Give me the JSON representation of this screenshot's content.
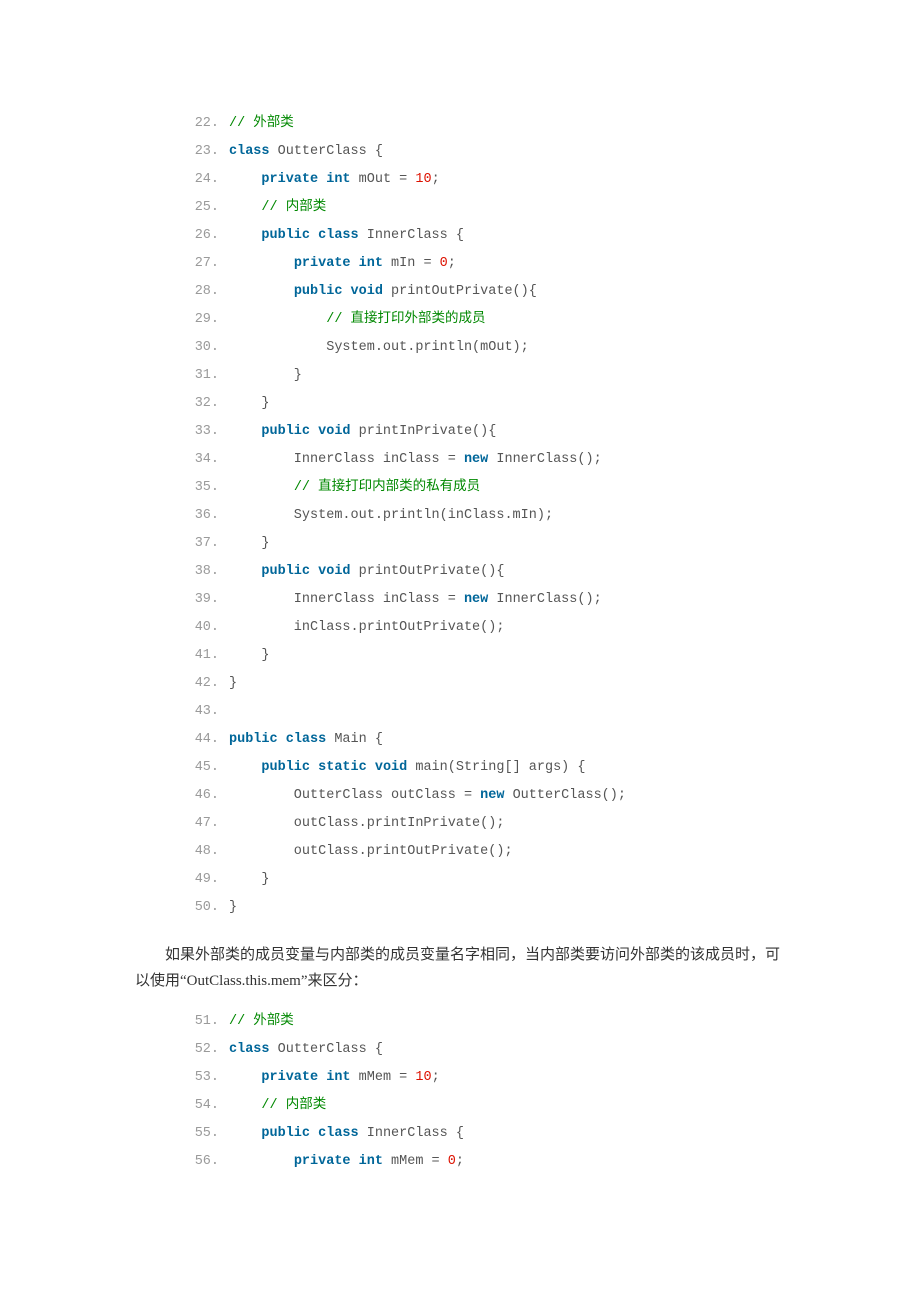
{
  "block1": {
    "lines": [
      {
        "n": 22,
        "tokens": [
          {
            "t": "cm",
            "v": "// 外部类"
          }
        ]
      },
      {
        "n": 23,
        "tokens": [
          {
            "t": "kw",
            "v": "class"
          },
          {
            "t": "",
            "v": " OutterClass {"
          }
        ]
      },
      {
        "n": 24,
        "tokens": [
          {
            "t": "",
            "v": "    "
          },
          {
            "t": "kw",
            "v": "private"
          },
          {
            "t": "",
            "v": " "
          },
          {
            "t": "kw",
            "v": "int"
          },
          {
            "t": "",
            "v": " mOut = "
          },
          {
            "t": "num",
            "v": "10"
          },
          {
            "t": "",
            "v": ";"
          }
        ]
      },
      {
        "n": 25,
        "tokens": [
          {
            "t": "",
            "v": "    "
          },
          {
            "t": "cm",
            "v": "// 内部类"
          }
        ]
      },
      {
        "n": 26,
        "tokens": [
          {
            "t": "",
            "v": "    "
          },
          {
            "t": "kw",
            "v": "public"
          },
          {
            "t": "",
            "v": " "
          },
          {
            "t": "kw",
            "v": "class"
          },
          {
            "t": "",
            "v": " InnerClass {"
          }
        ]
      },
      {
        "n": 27,
        "tokens": [
          {
            "t": "",
            "v": "        "
          },
          {
            "t": "kw",
            "v": "private"
          },
          {
            "t": "",
            "v": " "
          },
          {
            "t": "kw",
            "v": "int"
          },
          {
            "t": "",
            "v": " mIn = "
          },
          {
            "t": "num",
            "v": "0"
          },
          {
            "t": "",
            "v": ";"
          }
        ]
      },
      {
        "n": 28,
        "tokens": [
          {
            "t": "",
            "v": "        "
          },
          {
            "t": "kw",
            "v": "public"
          },
          {
            "t": "",
            "v": " "
          },
          {
            "t": "kw",
            "v": "void"
          },
          {
            "t": "",
            "v": " printOutPrivate(){"
          }
        ]
      },
      {
        "n": 29,
        "tokens": [
          {
            "t": "",
            "v": "            "
          },
          {
            "t": "cm",
            "v": "// 直接打印外部类的成员"
          }
        ]
      },
      {
        "n": 30,
        "tokens": [
          {
            "t": "",
            "v": "            System.out.println(mOut);"
          }
        ]
      },
      {
        "n": 31,
        "tokens": [
          {
            "t": "",
            "v": "        }"
          }
        ]
      },
      {
        "n": 32,
        "tokens": [
          {
            "t": "",
            "v": "    }"
          }
        ]
      },
      {
        "n": 33,
        "tokens": [
          {
            "t": "",
            "v": "    "
          },
          {
            "t": "kw",
            "v": "public"
          },
          {
            "t": "",
            "v": " "
          },
          {
            "t": "kw",
            "v": "void"
          },
          {
            "t": "",
            "v": " printInPrivate(){"
          }
        ]
      },
      {
        "n": 34,
        "tokens": [
          {
            "t": "",
            "v": "        InnerClass inClass = "
          },
          {
            "t": "kw",
            "v": "new"
          },
          {
            "t": "",
            "v": " InnerClass();"
          }
        ]
      },
      {
        "n": 35,
        "tokens": [
          {
            "t": "",
            "v": "        "
          },
          {
            "t": "cm",
            "v": "// 直接打印内部类的私有成员"
          }
        ]
      },
      {
        "n": 36,
        "tokens": [
          {
            "t": "",
            "v": "        System.out.println(inClass.mIn);"
          }
        ]
      },
      {
        "n": 37,
        "tokens": [
          {
            "t": "",
            "v": "    }"
          }
        ]
      },
      {
        "n": 38,
        "tokens": [
          {
            "t": "",
            "v": "    "
          },
          {
            "t": "kw",
            "v": "public"
          },
          {
            "t": "",
            "v": " "
          },
          {
            "t": "kw",
            "v": "void"
          },
          {
            "t": "",
            "v": " printOutPrivate(){"
          }
        ]
      },
      {
        "n": 39,
        "tokens": [
          {
            "t": "",
            "v": "        InnerClass inClass = "
          },
          {
            "t": "kw",
            "v": "new"
          },
          {
            "t": "",
            "v": " InnerClass();"
          }
        ]
      },
      {
        "n": 40,
        "tokens": [
          {
            "t": "",
            "v": "        inClass.printOutPrivate();"
          }
        ]
      },
      {
        "n": 41,
        "tokens": [
          {
            "t": "",
            "v": "    }"
          }
        ]
      },
      {
        "n": 42,
        "tokens": [
          {
            "t": "",
            "v": "}"
          }
        ]
      },
      {
        "n": 43,
        "tokens": [
          {
            "t": "",
            "v": ""
          }
        ]
      },
      {
        "n": 44,
        "tokens": [
          {
            "t": "kw",
            "v": "public"
          },
          {
            "t": "",
            "v": " "
          },
          {
            "t": "kw",
            "v": "class"
          },
          {
            "t": "",
            "v": " Main {"
          }
        ]
      },
      {
        "n": 45,
        "tokens": [
          {
            "t": "",
            "v": "    "
          },
          {
            "t": "kw",
            "v": "public"
          },
          {
            "t": "",
            "v": " "
          },
          {
            "t": "kw",
            "v": "static"
          },
          {
            "t": "",
            "v": " "
          },
          {
            "t": "kw",
            "v": "void"
          },
          {
            "t": "",
            "v": " main(String[] args) {"
          }
        ]
      },
      {
        "n": 46,
        "tokens": [
          {
            "t": "",
            "v": "        OutterClass outClass = "
          },
          {
            "t": "kw",
            "v": "new"
          },
          {
            "t": "",
            "v": " OutterClass();"
          }
        ]
      },
      {
        "n": 47,
        "tokens": [
          {
            "t": "",
            "v": "        outClass.printInPrivate();"
          }
        ]
      },
      {
        "n": 48,
        "tokens": [
          {
            "t": "",
            "v": "        outClass.printOutPrivate();"
          }
        ]
      },
      {
        "n": 49,
        "tokens": [
          {
            "t": "",
            "v": "    }"
          }
        ]
      },
      {
        "n": 50,
        "tokens": [
          {
            "t": "",
            "v": "}"
          }
        ]
      }
    ]
  },
  "paragraph1": "如果外部类的成员变量与内部类的成员变量名字相同，当内部类要访问外部类的该成员时，可以使用“OutClass.this.mem”来区分：",
  "block2": {
    "lines": [
      {
        "n": 51,
        "tokens": [
          {
            "t": "cm",
            "v": "// 外部类"
          }
        ]
      },
      {
        "n": 52,
        "tokens": [
          {
            "t": "kw",
            "v": "class"
          },
          {
            "t": "",
            "v": " OutterClass {"
          }
        ]
      },
      {
        "n": 53,
        "tokens": [
          {
            "t": "",
            "v": "    "
          },
          {
            "t": "kw",
            "v": "private"
          },
          {
            "t": "",
            "v": " "
          },
          {
            "t": "kw",
            "v": "int"
          },
          {
            "t": "",
            "v": " mMem = "
          },
          {
            "t": "num",
            "v": "10"
          },
          {
            "t": "",
            "v": ";"
          }
        ]
      },
      {
        "n": 54,
        "tokens": [
          {
            "t": "",
            "v": "    "
          },
          {
            "t": "cm",
            "v": "// 内部类"
          }
        ]
      },
      {
        "n": 55,
        "tokens": [
          {
            "t": "",
            "v": "    "
          },
          {
            "t": "kw",
            "v": "public"
          },
          {
            "t": "",
            "v": " "
          },
          {
            "t": "kw",
            "v": "class"
          },
          {
            "t": "",
            "v": " InnerClass {"
          }
        ]
      },
      {
        "n": 56,
        "tokens": [
          {
            "t": "",
            "v": "        "
          },
          {
            "t": "kw",
            "v": "private"
          },
          {
            "t": "",
            "v": " "
          },
          {
            "t": "kw",
            "v": "int"
          },
          {
            "t": "",
            "v": " mMem = "
          },
          {
            "t": "num",
            "v": "0"
          },
          {
            "t": "",
            "v": ";"
          }
        ]
      }
    ]
  }
}
